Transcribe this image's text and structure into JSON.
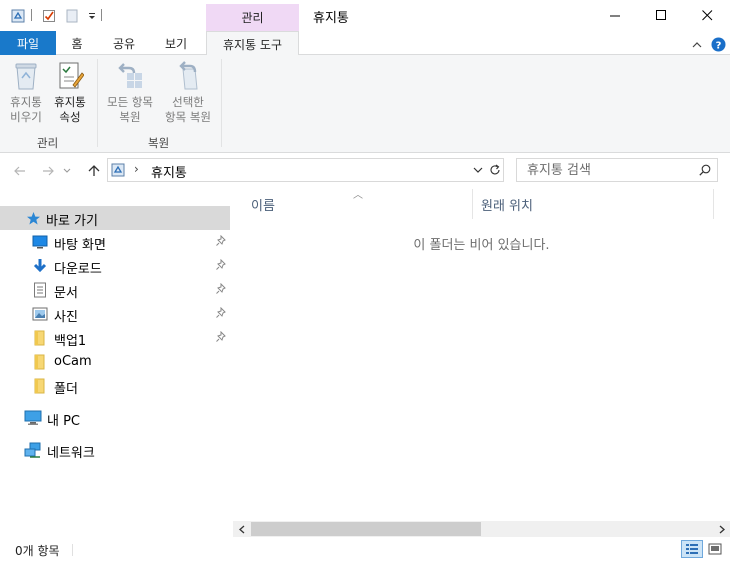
{
  "window": {
    "title": "휴지통",
    "context_tab_group": "관리"
  },
  "ribbon_tabs": [
    {
      "label": "파일"
    },
    {
      "label": "홈"
    },
    {
      "label": "공유"
    },
    {
      "label": "보기"
    },
    {
      "label": "휴지통 도구"
    }
  ],
  "ribbon": {
    "empty_bin_label_1": "휴지통",
    "empty_bin_label_2": "비우기",
    "properties_label_1": "휴지통",
    "properties_label_2": "속성",
    "restore_all_label_1": "모든 항목",
    "restore_all_label_2": "복원",
    "restore_selected_label_1": "선택한",
    "restore_selected_label_2": "항목 복원",
    "group_manage": "관리",
    "group_restore": "복원"
  },
  "address": {
    "path": "휴지통",
    "search_placeholder": "휴지통 검색"
  },
  "nav": {
    "quick_access": "바로 가기",
    "items": [
      {
        "label": "바탕 화면",
        "icon": "desktop-icon"
      },
      {
        "label": "다운로드",
        "icon": "download-icon"
      },
      {
        "label": "문서",
        "icon": "document-icon"
      },
      {
        "label": "사진",
        "icon": "pictures-icon"
      },
      {
        "label": "백업1",
        "icon": "folder-icon"
      },
      {
        "label": "oCam",
        "icon": "folder-icon"
      },
      {
        "label": "폴더",
        "icon": "folder-icon"
      }
    ],
    "this_pc": "내 PC",
    "network": "네트워크"
  },
  "content": {
    "columns": [
      "이름",
      "원래 위치"
    ],
    "empty_message": "이 폴더는 비어 있습니다."
  },
  "status": {
    "item_count": "0개 항목"
  },
  "colors": {
    "file_tab": "#1979ca",
    "context_tab": "#f0d9f5",
    "selection": "#d9d9d9",
    "column_header_text": "#4c607a"
  }
}
